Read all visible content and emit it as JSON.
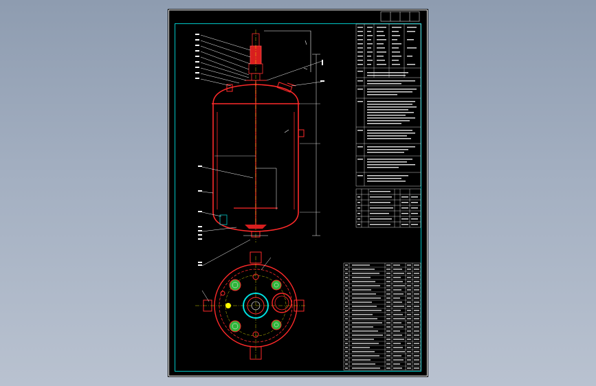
{
  "drawing": {
    "colors": {
      "background_outer": "#9aa6b8",
      "sheet": "#000000",
      "frame": "#00c8c8",
      "vessel": "#ff2a2a",
      "dimension": "#ffffff",
      "text": "#ffffff",
      "nozzle_green": "#3fd24a",
      "center_line": "#ffff00"
    },
    "views": [
      "front-elevation",
      "top-plan"
    ],
    "tables": [
      "technical-specs",
      "nozzle-table",
      "parts-list"
    ]
  }
}
